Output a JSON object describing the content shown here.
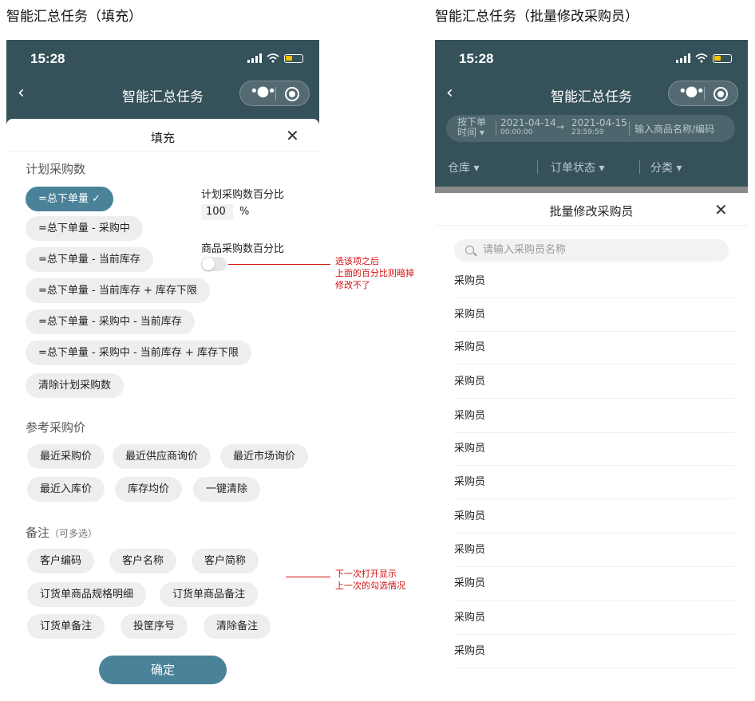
{
  "left_screen": {
    "caption": "智能汇总任务（填充）",
    "status_time": "15:28",
    "nav_title": "智能汇总任务",
    "sheet_title": "填充",
    "section_plan": "计划采购数",
    "plan_chips": [
      "=总下单量",
      "=总下单量 - 采购中",
      "=总下单量 - 当前库存",
      "=总下单量 - 当前库存 + 库存下限",
      "=总下单量 - 采购中 - 当前库存",
      "=总下单量 - 采购中 - 当前库存 + 库存下限",
      "清除计划采购数"
    ],
    "active_check": "✓",
    "pct_plan_label": "计划采购数百分比",
    "pct_plan_value": "100",
    "pct_unit": "%",
    "pct_goods_label": "商品采购数百分比",
    "section_ref": "参考采购价",
    "ref_chips": [
      "最近采购价",
      "最近供应商询价",
      "最近市场询价",
      "最近入库价",
      "库存均价",
      "一键清除"
    ],
    "section_remark": "备注",
    "section_remark_sub": "（可多选）",
    "remark_chips": [
      "客户编码",
      "客户名称",
      "客户简称",
      "订货单商品规格明细",
      "订货单商品备注",
      "订货单备注",
      "投筐序号",
      "清除备注"
    ],
    "confirm_label": "确定",
    "annotation_1": [
      "选该项之后",
      "上面的百分比则暗掉",
      "修改不了"
    ],
    "annotation_2": [
      "下一次打开显示",
      "上一次的勾选情况"
    ]
  },
  "right_screen": {
    "caption": "智能汇总任务（批量修改采购员）",
    "status_time": "15:28",
    "nav_title": "智能汇总任务",
    "filter_type": [
      "按下单",
      "时间 ▾"
    ],
    "date_start": "2021-04-14",
    "time_start": "00:00:00",
    "date_end": "2021-04-15",
    "time_end": "23:59:59",
    "search_goods_placeholder": "输入商品名称/编码",
    "categories": [
      "仓库 ▾",
      "订单状态 ▾",
      "分类 ▾"
    ],
    "sheet_title": "批量修改采购员",
    "buyer_search_placeholder": "请输入采购员名称",
    "buyers": [
      "采购员",
      "采购员",
      "采购员",
      "采购员",
      "采购员",
      "采购员",
      "采购员",
      "采购员",
      "采购员",
      "采购员",
      "采购员",
      "采购员"
    ]
  }
}
